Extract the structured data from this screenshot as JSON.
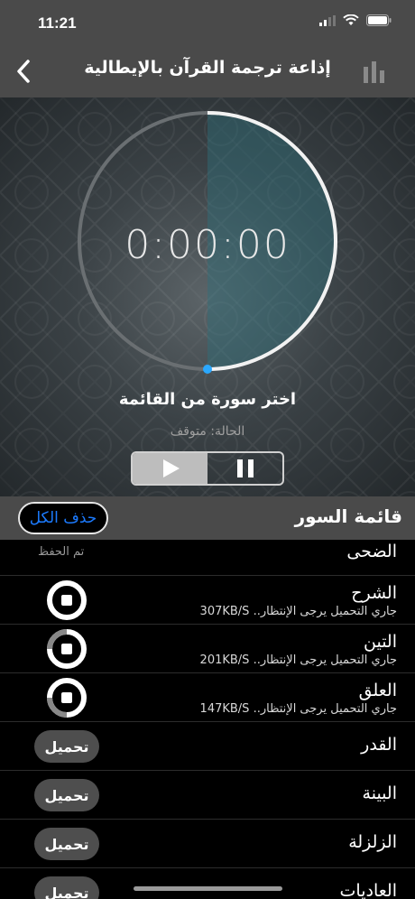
{
  "status_bar": {
    "time": "11:21"
  },
  "nav": {
    "title": "إذاعة ترجمة القرآن بالإيطالية"
  },
  "player": {
    "timer": "0:00:00",
    "prompt": "اختر سورة من القائمة",
    "status": "الحالة: متوقف",
    "progress_fraction": 0.5
  },
  "list_header": {
    "title": "قائمة السور",
    "delete_all": "حذف الكل"
  },
  "surahs": [
    {
      "name": "الضحى",
      "state_label": "تم الحفظ"
    },
    {
      "name": "الشرح",
      "subtitle": "جاري التحميل يرجى الإنتظار.. 307KB/S"
    },
    {
      "name": "التين",
      "subtitle": "جاري التحميل يرجى الإنتظار.. 201KB/S"
    },
    {
      "name": "العلق",
      "subtitle": "جاري التحميل يرجى الإنتظار.. 147KB/S"
    },
    {
      "name": "القدر",
      "button": "تحميل"
    },
    {
      "name": "البينة",
      "button": "تحميل"
    },
    {
      "name": "الزلزلة",
      "button": "تحميل"
    },
    {
      "name": "العاديات",
      "button": "تحميل"
    }
  ],
  "colors": {
    "accent": "#1c7bff",
    "progress_dot": "#2aa8ff",
    "bar_bg": "#4a4a4a"
  }
}
